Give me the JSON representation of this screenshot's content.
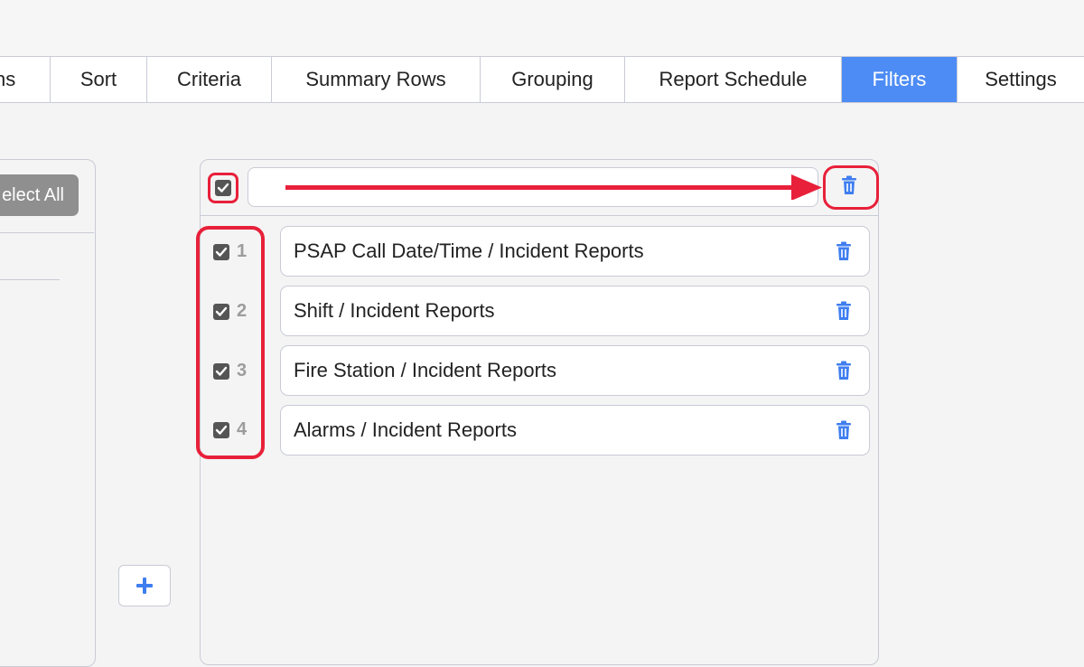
{
  "tabs": [
    {
      "label": "ns",
      "active": false
    },
    {
      "label": "Sort",
      "active": false
    },
    {
      "label": "Criteria",
      "active": false
    },
    {
      "label": "Summary Rows",
      "active": false
    },
    {
      "label": "Grouping",
      "active": false
    },
    {
      "label": "Report Schedule",
      "active": false
    },
    {
      "label": "Filters",
      "active": true
    },
    {
      "label": "Settings",
      "active": false
    }
  ],
  "left_panel": {
    "select_all_label": "elect All",
    "add_button_label": "+"
  },
  "filters": {
    "header_input_value": "",
    "rows": [
      {
        "number": "1",
        "label": "PSAP Call Date/Time / Incident Reports",
        "checked": true
      },
      {
        "number": "2",
        "label": "Shift / Incident Reports",
        "checked": true
      },
      {
        "number": "3",
        "label": "Fire Station / Incident Reports",
        "checked": true
      },
      {
        "number": "4",
        "label": "Alarms / Incident Reports",
        "checked": true
      }
    ]
  },
  "colors": {
    "active_tab": "#4d8cf5",
    "trash_icon": "#3f7ef0",
    "annotation_red": "#e8203a",
    "checkbox": "#555555"
  },
  "icons": {
    "checkbox": "check-square-icon",
    "delete": "trash-icon",
    "add": "plus-icon"
  }
}
